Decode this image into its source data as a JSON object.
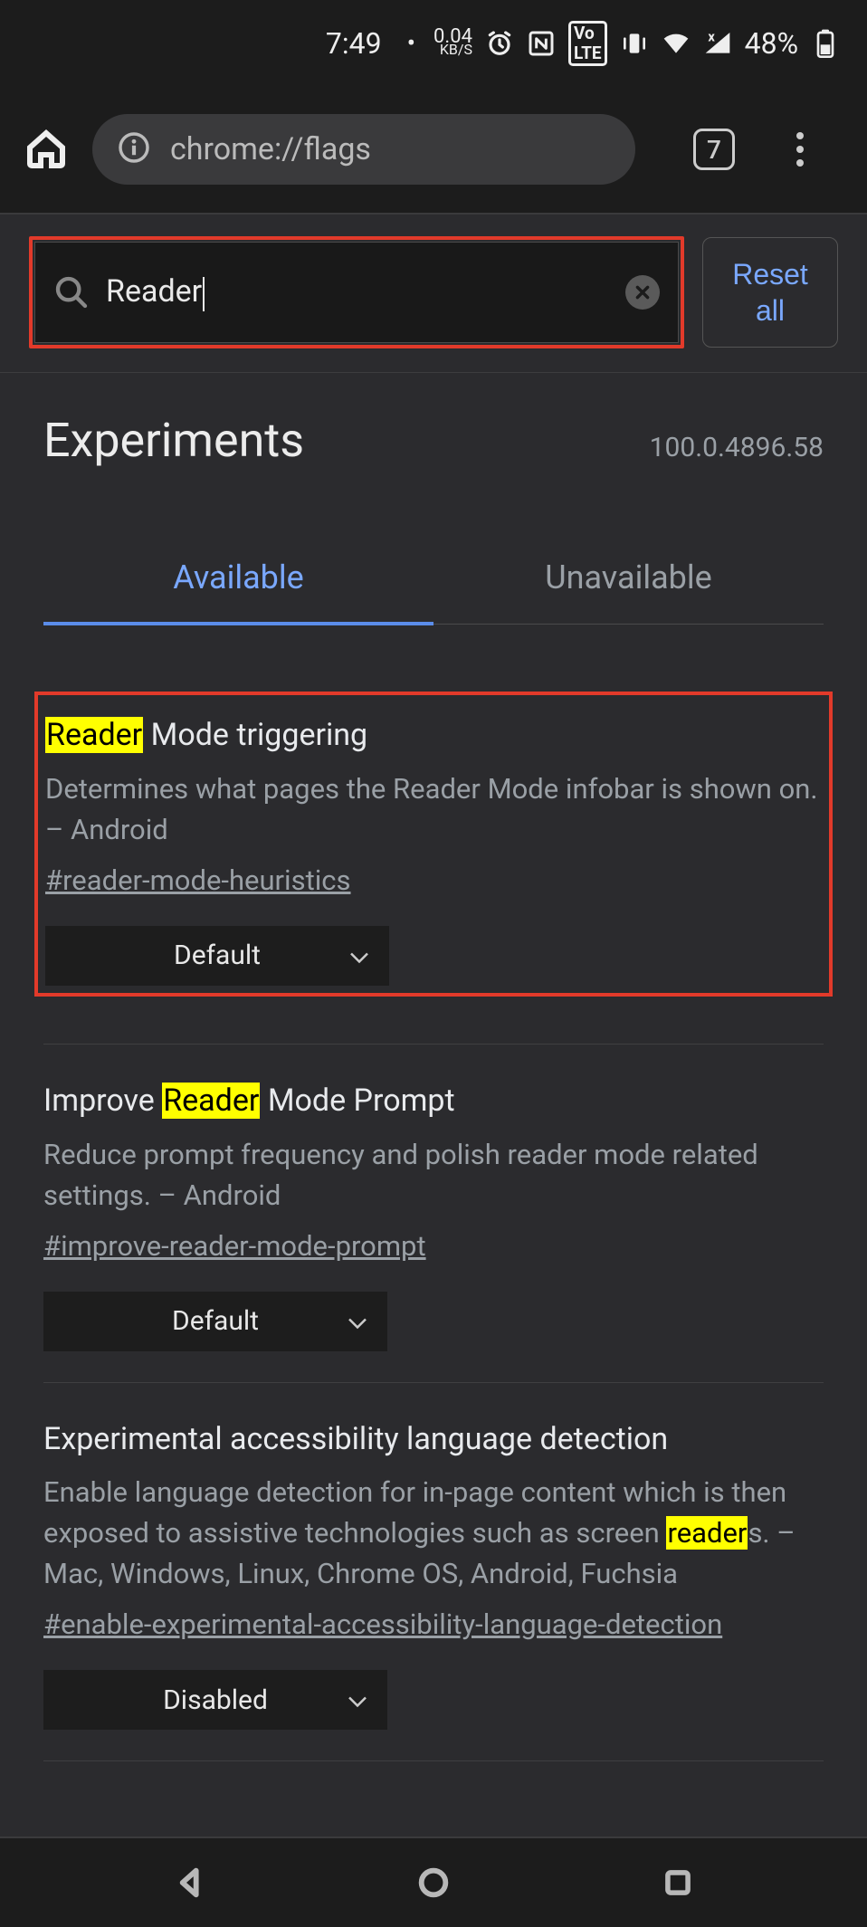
{
  "status": {
    "time": "7:49",
    "data_rate": "0.04",
    "data_unit": "KB/S",
    "battery_pct": "48%"
  },
  "browser": {
    "url": "chrome://flags",
    "tab_count": "7"
  },
  "search": {
    "value": "Reader",
    "reset_label": "Reset all"
  },
  "header": {
    "title": "Experiments",
    "version": "100.0.4896.58"
  },
  "tabs": {
    "available": "Available",
    "unavailable": "Unavailable"
  },
  "flags": [
    {
      "title_pre": "",
      "title_hl": "Reader",
      "title_post": " Mode triggering",
      "desc": "Determines what pages the Reader Mode infobar is shown on. – Android",
      "hash": "#reader-mode-heuristics",
      "select": "Default"
    },
    {
      "title_pre": "Improve ",
      "title_hl": "Reader",
      "title_post": " Mode Prompt",
      "desc": "Reduce prompt frequency and polish reader mode related settings. – Android",
      "hash": "#improve-reader-mode-prompt",
      "select": "Default"
    },
    {
      "title_pre": "Experimental accessibility language detection",
      "title_hl": "",
      "title_post": "",
      "desc_pre": "Enable language detection for in-page content which is then exposed to assistive technologies such as screen ",
      "desc_hl": "reader",
      "desc_post": "s. – Mac, Windows, Linux, Chrome OS, Android, Fuchsia",
      "hash": "#enable-experimental-accessibility-language-detection",
      "select": "Disabled"
    }
  ]
}
